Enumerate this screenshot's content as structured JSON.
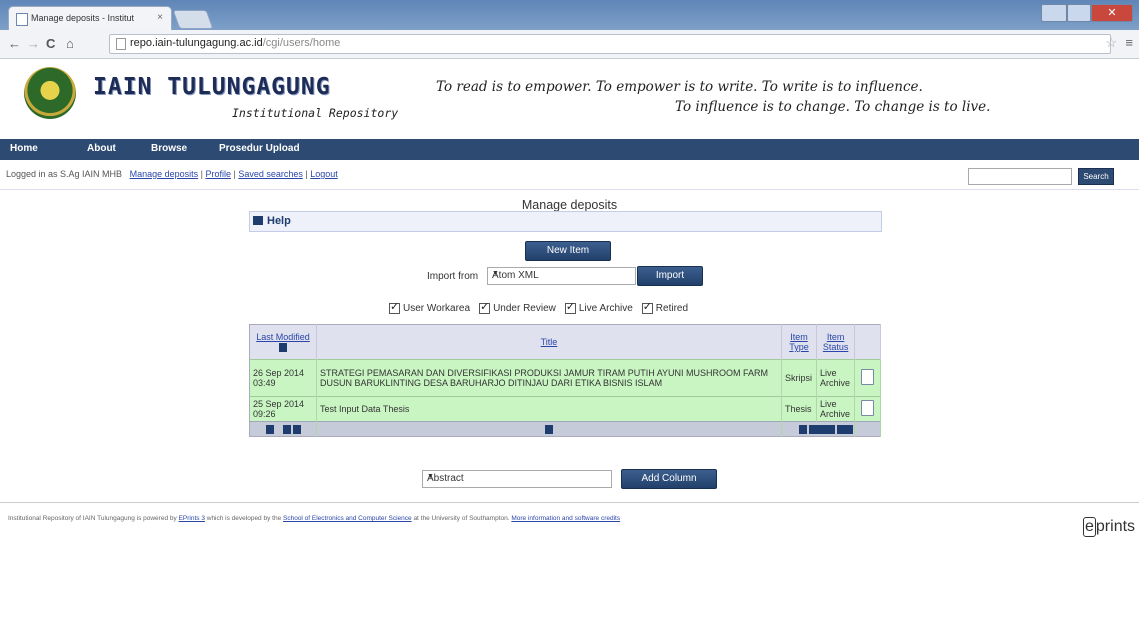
{
  "browser": {
    "tab_title": "Manage deposits - Institut",
    "tab_close": "×",
    "url_host": "repo.iain-tulungagung.ac.id",
    "url_path": "/cgi/users/home",
    "colors": {
      "chrome_frame": "#6a8fc0",
      "close_button": "#c9473d"
    }
  },
  "header": {
    "logo_title": "IAIN TULUNGAGUNG",
    "logo_subtitle": "Institutional Repository",
    "slogan_line1": "To read is to empower. To empower is to write. To write is to influence.",
    "slogan_line2": "To influence is to change. To change is to live."
  },
  "menu": {
    "items": [
      "Home",
      "About",
      "Browse",
      "Prosedur Upload"
    ],
    "color": "#2c4a72"
  },
  "login_bar": {
    "logged_in_text": "Logged in as S.Ag IAIN MHB",
    "links": [
      "Manage deposits",
      "Profile",
      "Saved searches",
      "Logout"
    ],
    "search_button": "Search"
  },
  "main": {
    "title": "Manage deposits",
    "help_label": "Help",
    "new_item_label": "New Item",
    "import_label": "Import from",
    "import_format": "Atom XML",
    "import_button": "Import",
    "filters": [
      "User Workarea",
      "Under Review",
      "Live Archive",
      "Retired"
    ],
    "table": {
      "headers": [
        "Last Modified",
        "Title",
        "Item Type",
        "Item Status"
      ],
      "rows": [
        {
          "modified": "26 Sep 2014 03:49",
          "title": "STRATEGI PEMASARAN DAN DIVERSIFIKASI PRODUKSI JAMUR TIRAM PUTIH AYUNI MUSHROOM FARM DUSUN BARUKLINTING DESA BARUHARJO DITINJAU DARI ETIKA BISNIS ISLAM",
          "type": "Skripsi",
          "status": "Live Archive"
        },
        {
          "modified": "25 Sep 2014 09:26",
          "title": "Test Input Data Thesis",
          "type": "Thesis",
          "status": "Live Archive"
        }
      ]
    },
    "column_select": "Abstract",
    "add_column_button": "Add Column"
  },
  "footer": {
    "text_prefix": "Institutional Repository of IAIN Tulungagung is powered by",
    "eprints_link": "EPrints 3",
    "text_mid": "which is developed by the",
    "school_link": "School of Electronics and Computer Science",
    "text_suffix": "at the University of Southampton.",
    "more_link": "More information and software credits",
    "logo": "eprints"
  }
}
